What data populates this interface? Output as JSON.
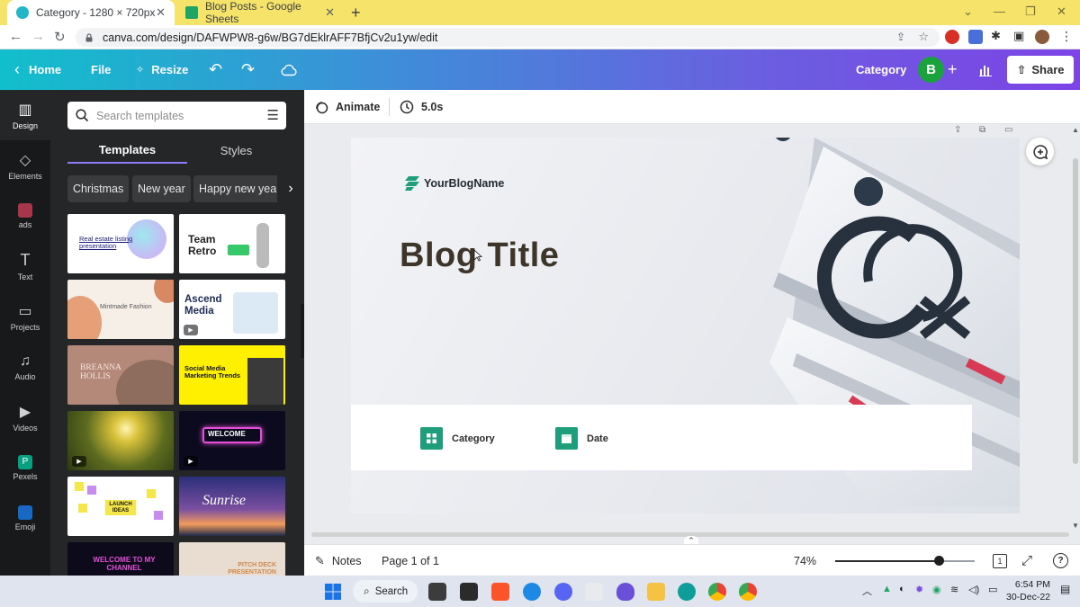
{
  "browser": {
    "tabs": [
      {
        "title": "Category - 1280 × 720px",
        "active": true
      },
      {
        "title": "Blog Posts - Google Sheets",
        "active": false
      }
    ],
    "url": "canva.com/design/DAFWPW8-g6w/BG7dEklrAFF7BfjCv2u1yw/edit"
  },
  "canva_header": {
    "home": "Home",
    "file": "File",
    "resize": "Resize",
    "design_name": "Category",
    "avatar_letter": "B",
    "share": "Share",
    "gradient_start": "#11bfcb",
    "gradient_end": "#7d43e6"
  },
  "rail": {
    "items": [
      {
        "label": "Design",
        "icon": "layout-icon"
      },
      {
        "label": "Elements",
        "icon": "shapes-icon"
      },
      {
        "label": "ads",
        "icon": "ads-icon"
      },
      {
        "label": "Text",
        "icon": "text-icon"
      },
      {
        "label": "Projects",
        "icon": "folder-icon"
      },
      {
        "label": "Audio",
        "icon": "music-icon"
      },
      {
        "label": "Videos",
        "icon": "video-icon"
      },
      {
        "label": "Pexels",
        "icon": "pexels-icon"
      },
      {
        "label": "Emoji",
        "icon": "emoji-icon"
      }
    ]
  },
  "panel": {
    "search_placeholder": "Search templates",
    "tabs": [
      "Templates",
      "Styles"
    ],
    "chips": [
      "Christmas",
      "New year",
      "Happy new year"
    ],
    "templates": [
      {
        "title": "Real estate listing presentation"
      },
      {
        "title": "Team Retro"
      },
      {
        "title": "Mintmade Fashion"
      },
      {
        "title": "Ascend Media"
      },
      {
        "title": "BREANNA HOLLIS"
      },
      {
        "title": "Social Media Marketing Trends"
      },
      {
        "title": ""
      },
      {
        "title": "WELCOME"
      },
      {
        "title": "LAUNCH IDEAS"
      },
      {
        "title": "Sunrise"
      },
      {
        "title": "WELCOME TO MY CHANNEL"
      },
      {
        "title": "PITCH DECK PRESENTATION"
      }
    ]
  },
  "editor": {
    "animate": "Animate",
    "duration": "5.0s",
    "slide": {
      "logo_text": "YourBlogName",
      "title": "Blog Title",
      "category_label": "Category",
      "date_label": "Date",
      "accent": "#1e9e7a"
    },
    "notes": "Notes",
    "page_indicator": "Page 1 of 1",
    "zoom": "74%",
    "zoom_level": 0.74,
    "page_count": "1"
  },
  "taskbar": {
    "search": "Search",
    "time": "6:54 PM",
    "date": "30-Dec-22"
  }
}
